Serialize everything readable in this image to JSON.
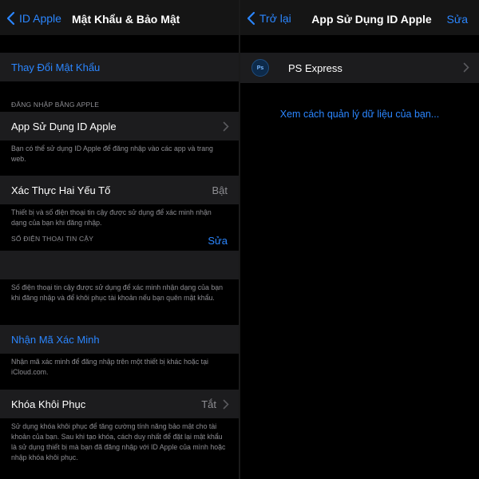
{
  "left": {
    "nav": {
      "back_label": "ID Apple",
      "title": "Mật Khẩu & Bảo Mật"
    },
    "change_password": "Thay Đổi Mật Khẩu",
    "sign_in_header": "ĐĂNG NHẬP BẰNG APPLE",
    "apps_using_id": "App Sử Dụng ID Apple",
    "apps_note": "Bạn có thể sử dụng ID Apple để đăng nhập vào các app và trang web.",
    "two_factor": {
      "label": "Xác Thực Hai Yếu Tố",
      "value": "Bật"
    },
    "two_factor_note": "Thiết bị và số điện thoại tin cậy được sử dụng để xác minh nhận dạng của bạn khi đăng nhập.",
    "trusted_header": "SỐ ĐIỆN THOẠI TIN CẬY",
    "edit_label": "Sửa",
    "trusted_note": "Số điện thoại tin cậy được sử dụng để xác minh nhận dạng của bạn khi đăng nhập và để khôi phục tài khoản nếu bạn quên mật khẩu.",
    "get_code": "Nhận Mã Xác Minh",
    "get_code_note": "Nhận mã xác minh để đăng nhập trên một thiết bị khác hoặc tại iCloud.com.",
    "recovery_key": {
      "label": "Khóa Khôi Phục",
      "value": "Tắt"
    },
    "recovery_note": "Sử dụng khóa khôi phục để tăng cường tính năng bảo mật cho tài khoản của bạn. Sau khi tạo khóa, cách duy nhất để đặt lại mật khẩu là sử dụng thiết bị mà bạn đã đăng nhập với ID Apple của mình hoặc nhập khóa khôi phục."
  },
  "right": {
    "nav": {
      "back_label": "Trở lại",
      "title": "App Sử Dụng ID Apple",
      "edit_label": "Sửa"
    },
    "app": {
      "icon_text": "Ps",
      "name": "PS Express"
    },
    "manage_link": "Xem cách quản lý dữ liệu của bạn..."
  }
}
